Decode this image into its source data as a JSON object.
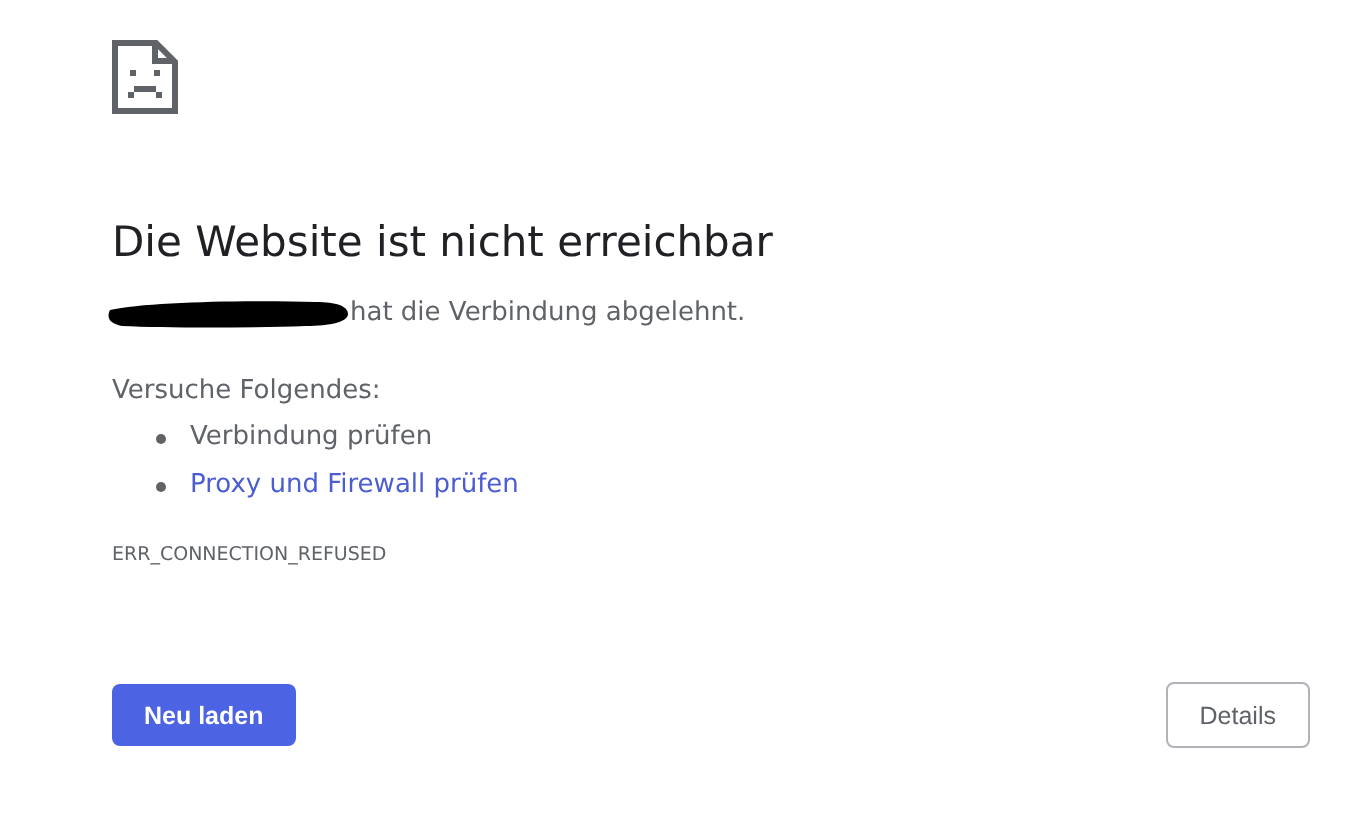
{
  "error_page": {
    "heading": "Die Website ist nicht erreichbar",
    "message": {
      "host_redacted": true,
      "text": "hat die Verbindung abgelehnt."
    },
    "suggestions_title": "Versuche Folgendes:",
    "suggestions": [
      {
        "kind": "text",
        "label": "Verbindung prüfen"
      },
      {
        "kind": "link",
        "label": "Proxy und Firewall prüfen"
      }
    ],
    "error_code": "ERR_CONNECTION_REFUSED",
    "buttons": [
      {
        "kind": "primary",
        "label": "Neu laden"
      },
      {
        "kind": "secondary",
        "label": "Details"
      }
    ]
  }
}
